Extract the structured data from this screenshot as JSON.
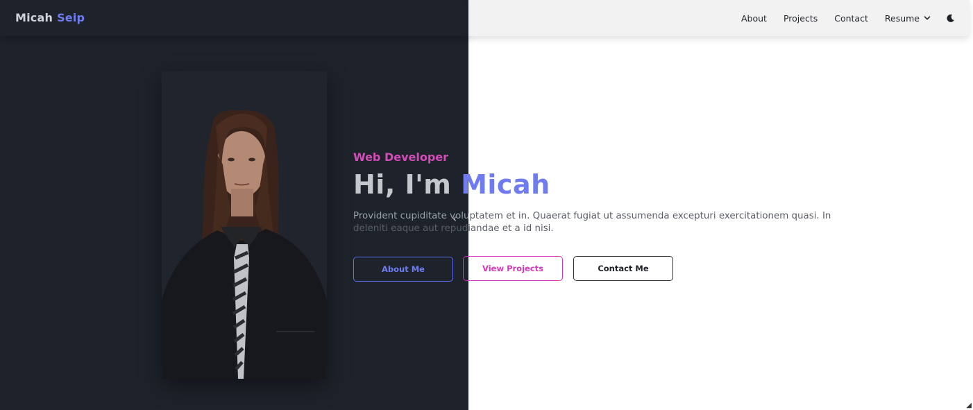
{
  "brand": {
    "first": "Micah",
    "last": "Seip"
  },
  "nav": {
    "about": "About",
    "projects": "Projects",
    "contact": "Contact",
    "resume": "Resume",
    "resume_icon": "chevron-down-icon",
    "theme_icon": "moon-icon"
  },
  "hero": {
    "subtitle": "Web Developer",
    "greeting": "Hi, I'm ",
    "name": "Micah",
    "description_part1": "Provident cupiditate volu",
    "description_part2": "ptatem et in. Quaerat fugiat ut assumenda excepturi exercitationem quasi. In deleniti eaque aut repudiandae et a id nisi.",
    "buttons": {
      "about": "About Me",
      "projects": "View Projects",
      "contact": "Contact Me"
    }
  },
  "colors": {
    "dark_bg": "#1e232b",
    "light_bg": "#ffffff",
    "accent_blue": "#6f7cf0",
    "accent_pink": "#d44cb8",
    "navbar_light": "#f2f2f2"
  }
}
